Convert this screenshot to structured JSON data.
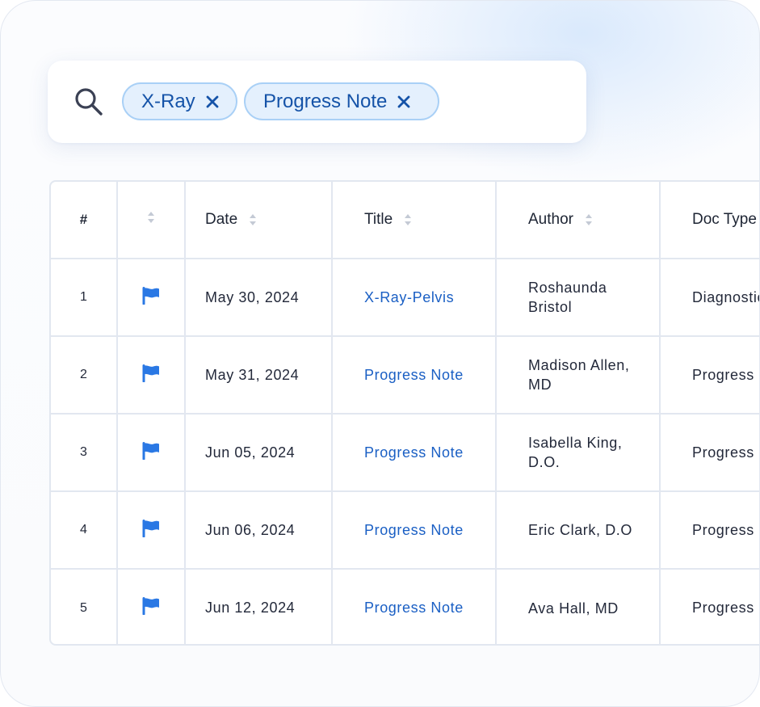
{
  "search": {
    "icon": "search-icon",
    "chips": [
      {
        "label": "X-Ray",
        "remove_icon": "close-icon"
      },
      {
        "label": "Progress Note",
        "remove_icon": "close-icon"
      }
    ]
  },
  "table": {
    "headers": {
      "num": "#",
      "flag": "",
      "date": "Date",
      "title": "Title",
      "author": "Author",
      "doc_type": "Doc Type"
    },
    "rows": [
      {
        "num": "1",
        "flag": "flag-icon",
        "date": "May 30, 2024",
        "title": "X-Ray-Pelvis",
        "author": "Roshaunda Bristol",
        "doc_type": "Diagnostic"
      },
      {
        "num": "2",
        "flag": "flag-icon",
        "date": "May 31, 2024",
        "title": "Progress Note",
        "author": "Madison Allen, MD",
        "doc_type": "Progress Note"
      },
      {
        "num": "3",
        "flag": "flag-icon",
        "date": "Jun 05, 2024",
        "title": "Progress Note",
        "author": "Isabella King, D.O.",
        "doc_type": "Progress Note"
      },
      {
        "num": "4",
        "flag": "flag-icon",
        "date": "Jun 06, 2024",
        "title": "Progress Note",
        "author": "Eric Clark, D.O",
        "doc_type": "Progress Note"
      },
      {
        "num": "5",
        "flag": "flag-icon",
        "date": "Jun 12, 2024",
        "title": "Progress Note",
        "author": "Ava Hall, MD",
        "doc_type": "Progress Note"
      }
    ]
  },
  "colors": {
    "accent": "#1a5fc4",
    "flag": "#2a78e4",
    "chip_bg": "#e4f0fd",
    "chip_border": "#a9d0f6",
    "grid": "#e2e7f0"
  }
}
